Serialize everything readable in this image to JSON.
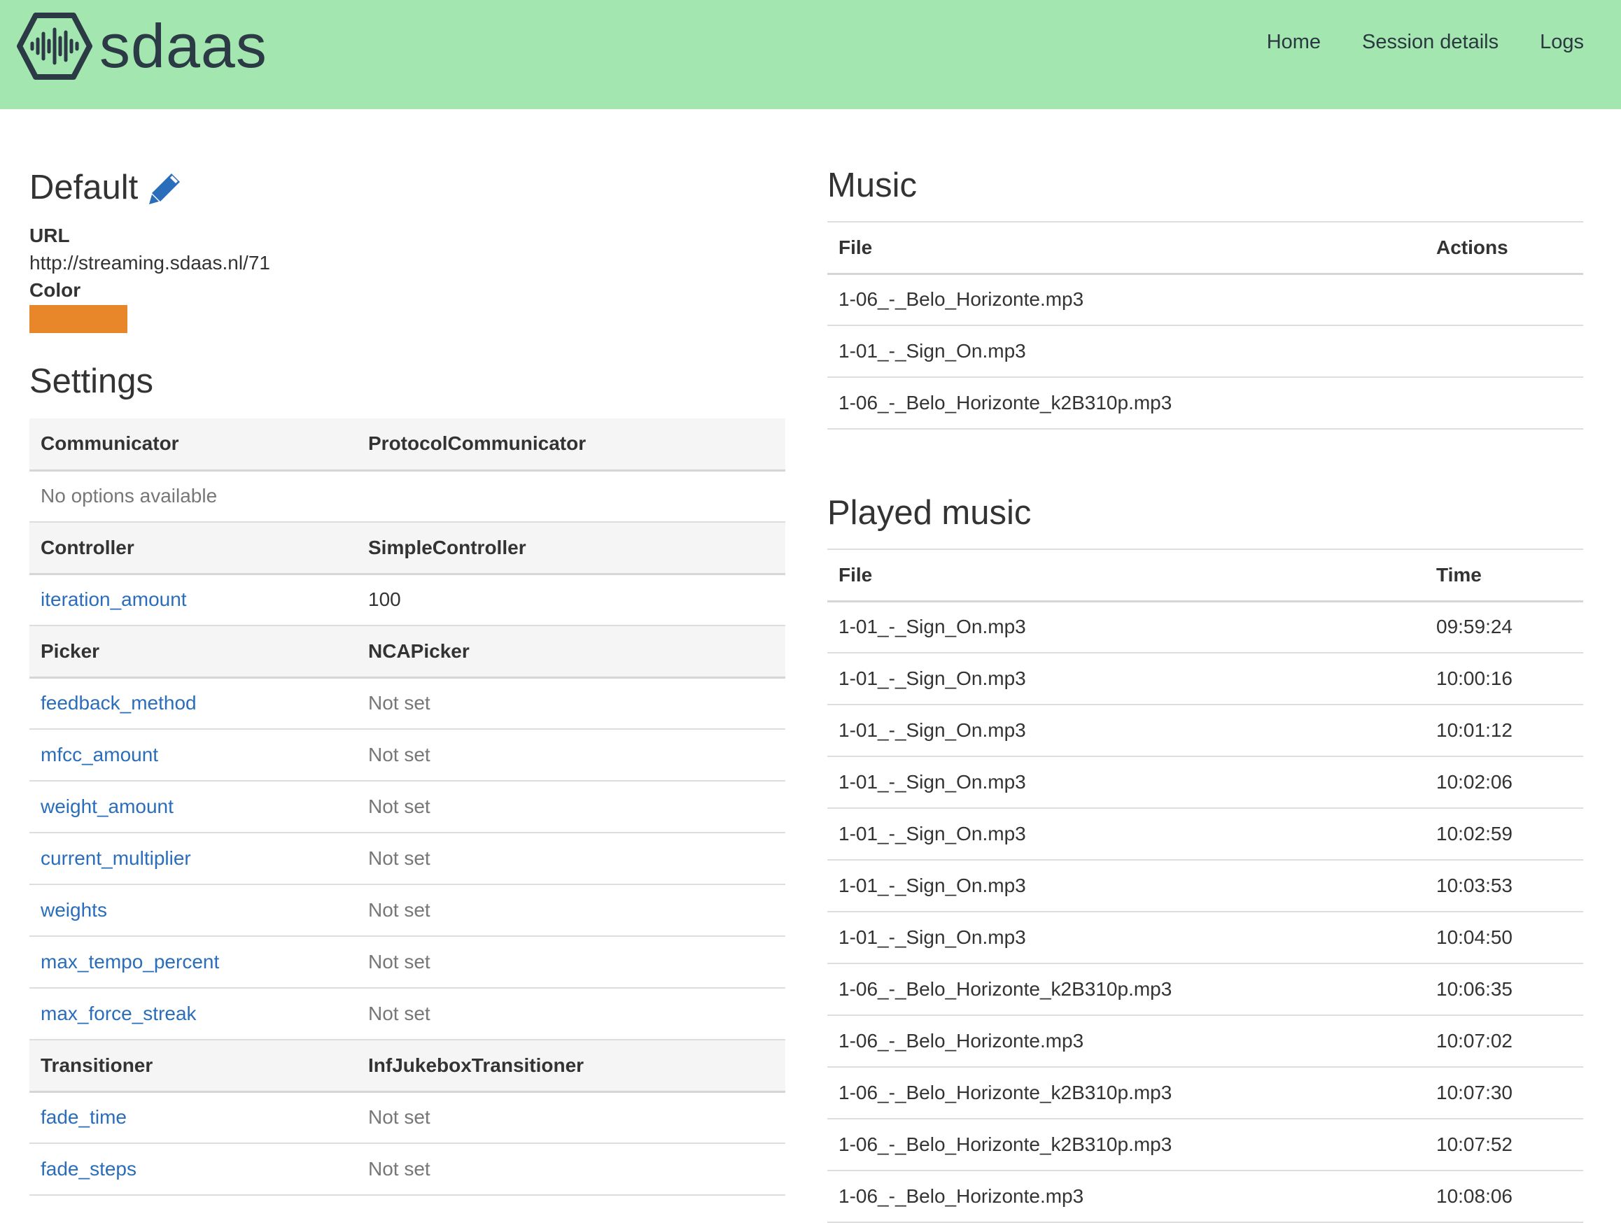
{
  "brand": {
    "name": "sdaas",
    "logo_icon": "waveform-hexagon-icon"
  },
  "nav": {
    "home": "Home",
    "session_details": "Session details",
    "logs": "Logs"
  },
  "colors": {
    "navbar": "#a3e6b0",
    "link": "#2a6ebb",
    "accent": "#e8862a"
  },
  "session": {
    "title": "Default",
    "edit_icon": "pencil-icon",
    "url_label": "URL",
    "url": "http://streaming.sdaas.nl/71",
    "color_label": "Color",
    "color": "#e8862a"
  },
  "settings": {
    "title": "Settings",
    "groups": [
      {
        "name": "Communicator",
        "value": "ProtocolCommunicator",
        "empty_text": "No options available",
        "options": []
      },
      {
        "name": "Controller",
        "value": "SimpleController",
        "options": [
          {
            "name": "iteration_amount",
            "value": "100"
          }
        ]
      },
      {
        "name": "Picker",
        "value": "NCAPicker",
        "options": [
          {
            "name": "feedback_method",
            "value": "Not set"
          },
          {
            "name": "mfcc_amount",
            "value": "Not set"
          },
          {
            "name": "weight_amount",
            "value": "Not set"
          },
          {
            "name": "current_multiplier",
            "value": "Not set"
          },
          {
            "name": "weights",
            "value": "Not set"
          },
          {
            "name": "max_tempo_percent",
            "value": "Not set"
          },
          {
            "name": "max_force_streak",
            "value": "Not set"
          }
        ]
      },
      {
        "name": "Transitioner",
        "value": "InfJukeboxTransitioner",
        "options": [
          {
            "name": "fade_time",
            "value": "Not set"
          },
          {
            "name": "fade_steps",
            "value": "Not set"
          }
        ]
      }
    ]
  },
  "music": {
    "title": "Music",
    "columns": [
      "File",
      "Actions"
    ],
    "rows": [
      {
        "file": "1-06_-_Belo_Horizonte.mp3",
        "actions": ""
      },
      {
        "file": "1-01_-_Sign_On.mp3",
        "actions": ""
      },
      {
        "file": "1-06_-_Belo_Horizonte_k2B310p.mp3",
        "actions": ""
      }
    ]
  },
  "played_music": {
    "title": "Played music",
    "columns": [
      "File",
      "Time"
    ],
    "rows": [
      {
        "file": "1-01_-_Sign_On.mp3",
        "time": "09:59:24"
      },
      {
        "file": "1-01_-_Sign_On.mp3",
        "time": "10:00:16"
      },
      {
        "file": "1-01_-_Sign_On.mp3",
        "time": "10:01:12"
      },
      {
        "file": "1-01_-_Sign_On.mp3",
        "time": "10:02:06"
      },
      {
        "file": "1-01_-_Sign_On.mp3",
        "time": "10:02:59"
      },
      {
        "file": "1-01_-_Sign_On.mp3",
        "time": "10:03:53"
      },
      {
        "file": "1-01_-_Sign_On.mp3",
        "time": "10:04:50"
      },
      {
        "file": "1-06_-_Belo_Horizonte_k2B310p.mp3",
        "time": "10:06:35"
      },
      {
        "file": "1-06_-_Belo_Horizonte.mp3",
        "time": "10:07:02"
      },
      {
        "file": "1-06_-_Belo_Horizonte_k2B310p.mp3",
        "time": "10:07:30"
      },
      {
        "file": "1-06_-_Belo_Horizonte_k2B310p.mp3",
        "time": "10:07:52"
      },
      {
        "file": "1-06_-_Belo_Horizonte.mp3",
        "time": "10:08:06"
      }
    ]
  }
}
